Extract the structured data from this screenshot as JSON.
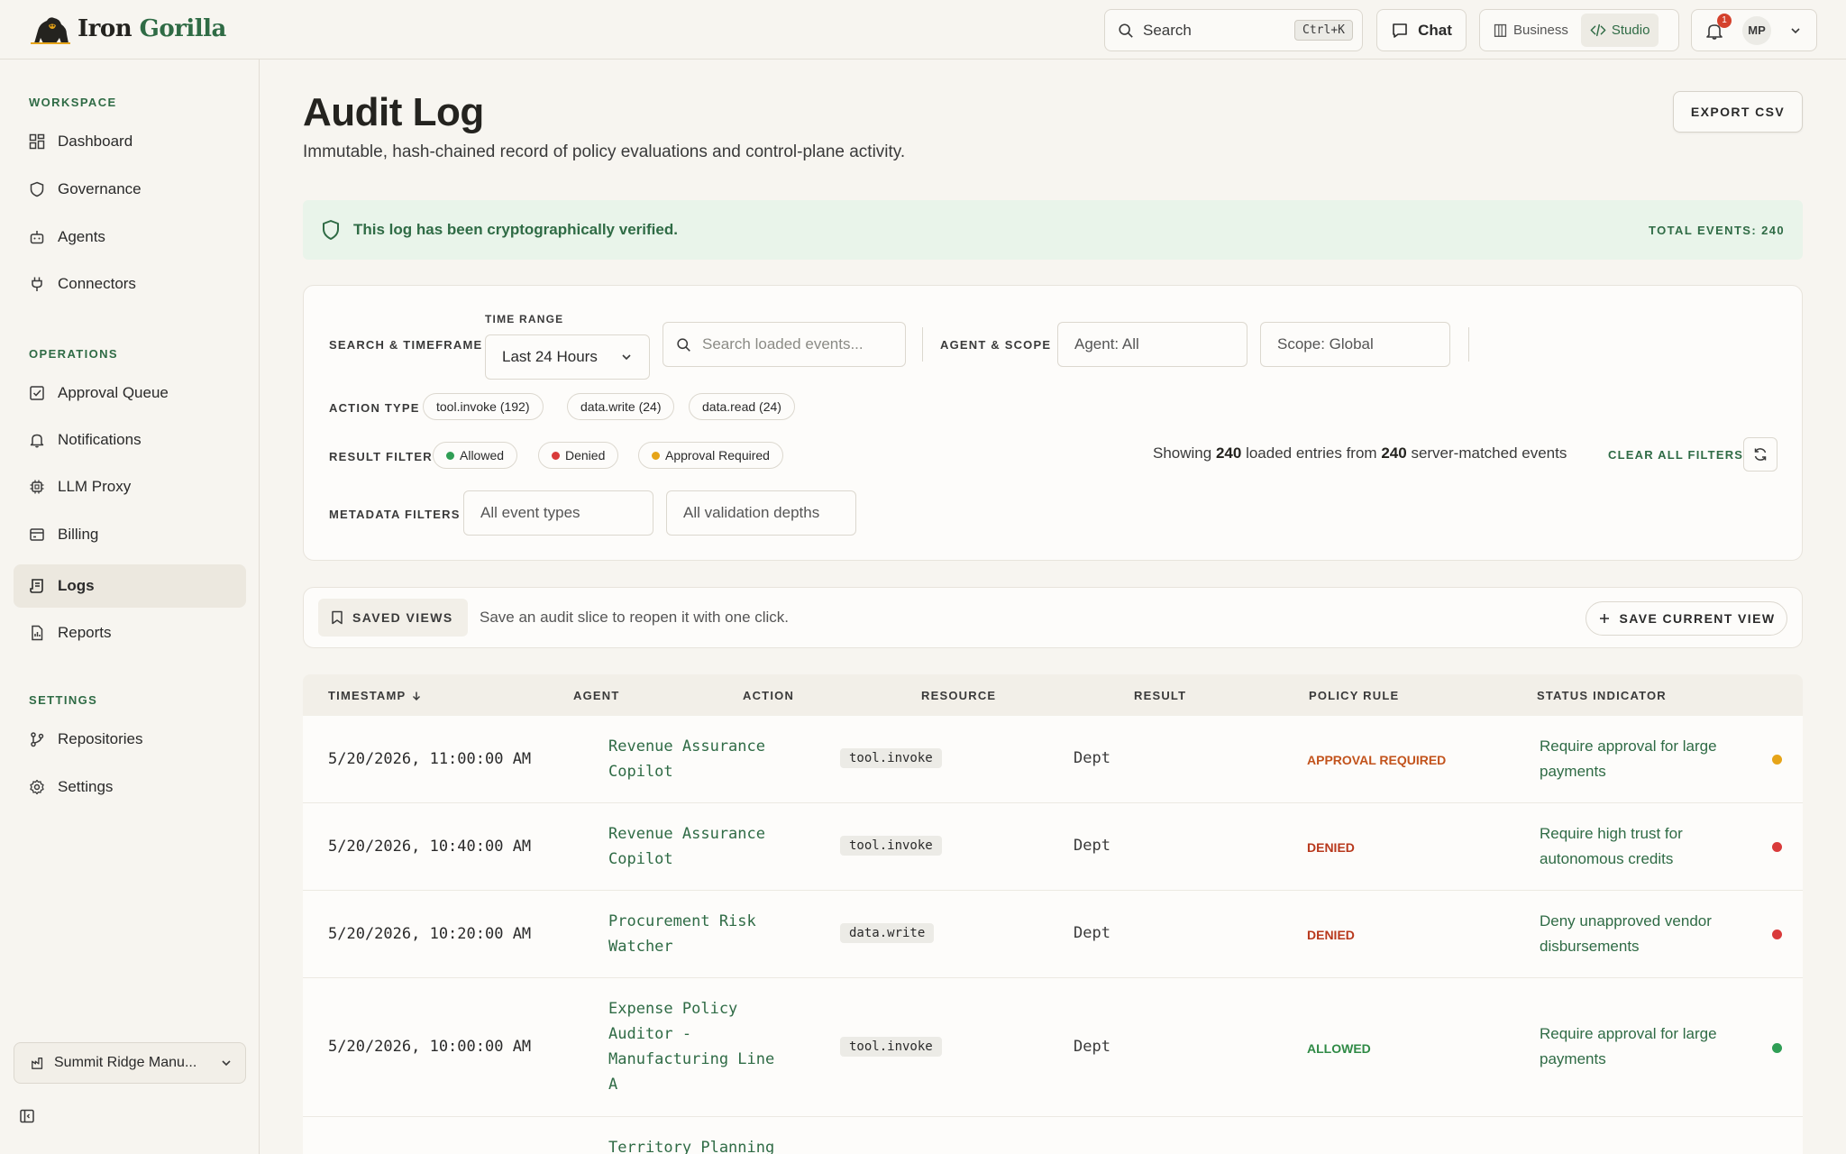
{
  "brand": {
    "name_part1": "Iron",
    "name_part2": "Gorilla"
  },
  "header": {
    "search_label": "Search",
    "search_shortcut": "Ctrl+K",
    "chat_label": "Chat",
    "modes": [
      "Business",
      "Studio"
    ],
    "active_mode": "Studio",
    "notification_count": "1",
    "user_initials": "MP"
  },
  "sidebar": {
    "sections": {
      "workspace": "WORKSPACE",
      "operations": "OPERATIONS",
      "settings": "SETTINGS"
    },
    "items": {
      "dashboard": "Dashboard",
      "governance": "Governance",
      "agents": "Agents",
      "connectors": "Connectors",
      "approval_queue": "Approval Queue",
      "notifications": "Notifications",
      "llm_proxy": "LLM Proxy",
      "billing": "Billing",
      "logs": "Logs",
      "reports": "Reports",
      "repositories": "Repositories",
      "settings": "Settings"
    },
    "active_item": "Logs",
    "org_selector": "Summit Ridge Manu..."
  },
  "page": {
    "title": "Audit Log",
    "subtitle": "Immutable, hash-chained record of policy evaluations and control-plane activity.",
    "export_label": "EXPORT CSV",
    "verified_message": "This log has been cryptographically verified.",
    "total_events": "TOTAL EVENTS: 240"
  },
  "filters": {
    "search_timeframe_label": "SEARCH & TIMEFRAME",
    "time_range_label": "TIME RANGE",
    "time_range_value": "Last 24 Hours",
    "search_placeholder": "Search loaded events...",
    "agent_scope_label": "AGENT & SCOPE",
    "agent_value": "Agent: All",
    "scope_value": "Scope: Global",
    "action_type_label": "ACTION TYPE",
    "action_types": [
      "tool.invoke (192)",
      "data.write (24)",
      "data.read (24)"
    ],
    "result_filter_label": "RESULT FILTER",
    "result_filters": [
      "Allowed",
      "Denied",
      "Approval Required"
    ],
    "showing_prefix": "Showing",
    "loaded_count": "240",
    "showing_middle": "loaded entries from",
    "matched_count": "240",
    "showing_suffix": "server-matched events",
    "clear_all_label": "CLEAR ALL FILTERS",
    "metadata_label": "METADATA FILTERS",
    "event_types_value": "All event types",
    "validation_depths_value": "All validation depths"
  },
  "saved_views": {
    "label": "SAVED VIEWS",
    "description": "Save an audit slice to reopen it with one click.",
    "save_label": "SAVE CURRENT VIEW"
  },
  "table": {
    "headers": [
      "TIMESTAMP",
      "AGENT",
      "ACTION",
      "RESOURCE",
      "RESULT",
      "POLICY RULE",
      "STATUS INDICATOR"
    ],
    "rows": [
      {
        "timestamp": "5/20/2026, 11:00:00 AM",
        "agent": "Revenue Assurance Copilot",
        "action": "tool.invoke",
        "resource": "Dept",
        "result": "APPROVAL REQUIRED",
        "rule": "Require approval for large payments"
      },
      {
        "timestamp": "5/20/2026, 10:40:00 AM",
        "agent": "Revenue Assurance Copilot",
        "action": "tool.invoke",
        "resource": "Dept",
        "result": "DENIED",
        "rule": "Require high trust for autonomous credits"
      },
      {
        "timestamp": "5/20/2026, 10:20:00 AM",
        "agent": "Procurement Risk Watcher",
        "action": "data.write",
        "resource": "Dept",
        "result": "DENIED",
        "rule": "Deny unapproved vendor disbursements"
      },
      {
        "timestamp": "5/20/2026, 10:00:00 AM",
        "agent": "Expense Policy Auditor - Manufacturing Line A",
        "action": "tool.invoke",
        "resource": "Dept",
        "result": "ALLOWED",
        "rule": "Require approval for large payments"
      },
      {
        "timestamp": "",
        "agent": "Territory Planning",
        "action": "",
        "resource": "",
        "result": "",
        "rule": ""
      }
    ]
  },
  "colors": {
    "accent": "#2f6b45",
    "approval": "#e6a418",
    "denied": "#d93a3a",
    "allowed": "#2f9e55",
    "approval_text": "#c2531c",
    "denied_text": "#b8381c",
    "allowed_text": "#2f8a45"
  }
}
